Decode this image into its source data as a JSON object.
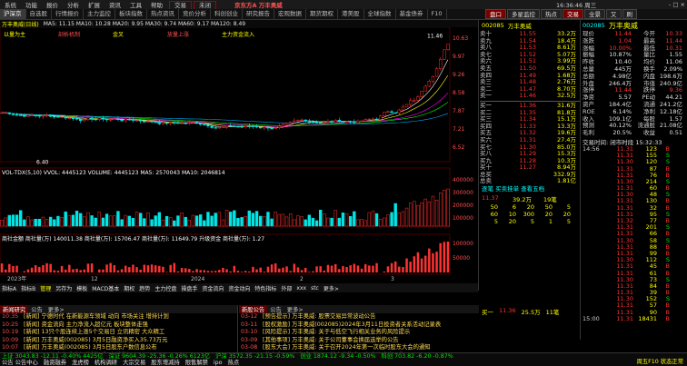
{
  "window": {
    "menu": [
      "系统",
      "功能",
      "报价",
      "分析",
      "扩展",
      "资讯",
      "工具",
      "帮助"
    ],
    "brand": "京东方A  万丰奥威",
    "broker_pills": [
      "交易",
      "未闭"
    ],
    "clock": "16:36:46 周三",
    "controls": "- □ ×"
  },
  "tabs": [
    "沪深京",
    "自选股",
    "行情报价",
    "主力监控",
    "板块指数",
    "热点资讯",
    "竞价分析",
    "科创创业",
    "研究报告",
    "宏观数据",
    "期货期权",
    "港美股",
    "全球指数",
    "基金债券",
    "F10"
  ],
  "active_tab": "沪深京",
  "right_tabs": [
    {
      "label": "盘口",
      "red": true
    },
    {
      "label": "多星监控",
      "red": false
    },
    {
      "label": "热点",
      "red": false
    },
    {
      "label": "交易",
      "red": true
    },
    {
      "label": "全景",
      "red": false
    },
    {
      "label": "又",
      "red": false
    },
    {
      "label": "刷",
      "red": false
    }
  ],
  "chart": {
    "stock_title": "万丰奥威(日线)",
    "ma_line": "MA5: 11.15  MA10: 10.28  MA20: 9.95  MA30: 9.74  MA60: 9.17  MA120: 8.49",
    "kline_labels": [
      "以量为主",
      "剖析机制",
      "金叉",
      "放量上涨",
      "主力资金流入"
    ],
    "price_high_label": "11.46",
    "price_low_label": "6.40",
    "price_axis": [
      "10.63",
      "9.97",
      "9.26",
      "8.58",
      "7.87",
      "7.21",
      "6.52"
    ],
    "volume_label": "VOL-TDX(5,10)  VVOL: 4445123  VOLUME: 4445123  MA5: 2570043  MA10: 2046814",
    "volume_axis": [
      "400000",
      "300000",
      "200000",
      "100000"
    ],
    "macd_label": "商社金额 商社量(万) 140011.38  商社量(万): 15706.47  商社量(万): 11649.79  升级资金 商社量(万): 1.27",
    "macd_axis": [
      "100000",
      "50000"
    ],
    "date_labels": [
      "2023年",
      "12",
      "2024",
      "2",
      "3"
    ],
    "bottom_tabs": [
      "指标A",
      "指标B",
      "管理",
      "另存为",
      "模板",
      "MACD基本",
      "期权",
      "趋势",
      "主力控盘",
      "操盘手",
      "资金流向",
      "资金动向",
      "特色指标",
      "外部",
      "xxx",
      "stc",
      "更多>"
    ]
  },
  "quote": {
    "stock_code": "002085",
    "stock_name": "万丰奥威",
    "sells": [
      {
        "label": "卖十",
        "price": "11.55",
        "vol": "33.2万"
      },
      {
        "label": "卖九",
        "price": "11.54",
        "vol": "18.4万"
      },
      {
        "label": "卖八",
        "price": "11.53",
        "vol": "8.61万"
      },
      {
        "label": "卖七",
        "price": "11.52",
        "vol": "5.07万"
      },
      {
        "label": "卖六",
        "price": "11.51",
        "vol": "3.99万"
      },
      {
        "label": "卖五",
        "price": "11.50",
        "vol": "69.5万"
      },
      {
        "label": "卖四",
        "price": "11.49",
        "vol": "1.68万"
      },
      {
        "label": "卖三",
        "price": "11.48",
        "vol": "2.76万"
      },
      {
        "label": "卖二",
        "price": "11.47",
        "vol": "8.70万"
      },
      {
        "label": "卖一",
        "price": "11.46",
        "vol": "32.5万"
      }
    ],
    "buys": [
      {
        "label": "买一",
        "price": "11.36",
        "vol": "31.6万"
      },
      {
        "label": "买二",
        "price": "11.35",
        "vol": "81.8万"
      },
      {
        "label": "买三",
        "price": "11.34",
        "vol": "15.1万"
      },
      {
        "label": "买四",
        "price": "11.33",
        "vol": "13.3万"
      },
      {
        "label": "买五",
        "price": "11.32",
        "vol": "19.6万"
      },
      {
        "label": "买六",
        "price": "11.31",
        "vol": "27.4万"
      },
      {
        "label": "买七",
        "price": "11.30",
        "vol": "85.0万"
      },
      {
        "label": "买八",
        "price": "11.29",
        "vol": "15.3万"
      },
      {
        "label": "买九",
        "price": "11.28",
        "vol": "10.3万"
      },
      {
        "label": "买十",
        "price": "11.27",
        "vol": "8.94万"
      }
    ],
    "sum_rows": [
      {
        "label": "总买",
        "price": "",
        "vol": "332.9万"
      },
      {
        "label": "总卖",
        "price": "",
        "vol": "1.81亿"
      }
    ],
    "hint": "逐笔 买卖挂单 查看五档",
    "big_order_hdr": [
      "11.37",
      "39.2万",
      "19笔"
    ],
    "big_order_rows": [
      [
        "50",
        "6",
        "20",
        "50",
        "5"
      ],
      [
        "60",
        "10",
        "300",
        "20",
        "20"
      ],
      [
        "5",
        "20",
        "5",
        "1",
        "5"
      ]
    ],
    "bottom_order": {
      "label": "买一",
      "price": "11.36",
      "vol": "25.5万",
      "count": "11笔"
    }
  },
  "info": {
    "code": "002085",
    "name": "万丰奥威",
    "rows": [
      [
        "现价",
        "11.44",
        "今开",
        "10.33"
      ],
      [
        "涨跌",
        "1.04",
        "最高",
        "11.44"
      ],
      [
        "涨幅",
        "10.00%",
        "最低",
        "10.31"
      ],
      [
        "振幅",
        "10.87%",
        "量比",
        "1.55"
      ],
      [
        "昨收",
        "10.40",
        "均价",
        "11.06"
      ],
      [
        "总量",
        "445万",
        "换手",
        "2.09%"
      ],
      [
        "总额",
        "4.98亿",
        "内盘",
        "198.6万"
      ],
      [
        "外盘",
        "246.4万",
        "市值",
        "240.9亿"
      ],
      [
        "涨停",
        "11.44",
        "跌停",
        "9.36"
      ],
      [
        "净资",
        "5.57",
        "PE动",
        "44.21"
      ],
      [
        "资产",
        "184.4亿",
        "流通",
        "241.2亿"
      ],
      [
        "ROE",
        "6.14%",
        "净利",
        "12.18亿"
      ],
      [
        "收入",
        "109.1亿",
        "每股",
        "1.57"
      ],
      [
        "预测",
        "40.12%",
        "流通股",
        "21.08亿"
      ],
      [
        "毛利",
        "20.5%",
        "收益",
        "0.51"
      ]
    ],
    "session": "交易时间: 闭市时段  15:32:33",
    "ticks": [
      [
        "14:56",
        "11.31",
        "123",
        "B"
      ],
      [
        "",
        "11.31",
        "155",
        "S"
      ],
      [
        "",
        "11.30",
        "120",
        "S"
      ],
      [
        "",
        "11.31",
        "87",
        "B"
      ],
      [
        "",
        "11.31",
        "76",
        "B"
      ],
      [
        "",
        "11.30",
        "214",
        "S"
      ],
      [
        "",
        "11.31",
        "60",
        "B"
      ],
      [
        "",
        "11.30",
        "48",
        "S"
      ],
      [
        "",
        "11.31",
        "130",
        "B"
      ],
      [
        "",
        "11.31",
        "32",
        "B"
      ],
      [
        "",
        "11.31",
        "95",
        "S"
      ],
      [
        "",
        "11.32",
        "77",
        "B"
      ],
      [
        "",
        "11.31",
        "201",
        "S"
      ],
      [
        "",
        "11.31",
        "66",
        "B"
      ],
      [
        "",
        "11.30",
        "58",
        "S"
      ],
      [
        "",
        "11.31",
        "88",
        "B"
      ],
      [
        "",
        "11.31",
        "99",
        "B"
      ],
      [
        "",
        "11.30",
        "112",
        "S"
      ],
      [
        "",
        "11.31",
        "45",
        "B"
      ],
      [
        "",
        "11.31",
        "61",
        "B"
      ],
      [
        "",
        "11.30",
        "73",
        "S"
      ],
      [
        "",
        "11.31",
        "84",
        "B"
      ],
      [
        "",
        "11.31",
        "39",
        "B"
      ],
      [
        "",
        "11.30",
        "152",
        "S"
      ],
      [
        "",
        "11.31",
        "57",
        "B"
      ],
      [
        "",
        "11.31",
        "90",
        "B"
      ],
      [
        "15:00",
        "11.31",
        "18431",
        "B"
      ]
    ]
  },
  "news": {
    "left_tabs": [
      "新闻研究",
      "公告",
      "更多>"
    ],
    "left_items": [
      {
        "time": "10:35",
        "text": "[新闻] 宁德时代 在新能源车领域 动向 市场关注 增持计划"
      },
      {
        "time": "10:25",
        "text": "[新闻] 资金流向 主力净流入超亿元 板块整体走强"
      },
      {
        "time": "10:19",
        "text": "[新闻] 13只个股连续上涨5个交易日 立讯精密 大众精工"
      },
      {
        "time": "10:09",
        "text": "[新闻] 万丰奥威(002085) 3月5日融资净买入35.73万元"
      },
      {
        "time": "10:07",
        "text": "[新闻] 万丰奥威(002085) 3月5日股东户数信息公布"
      },
      {
        "time": "10:04",
        "text": "[新闻] 1月汽车行业市场分析报告 产销数据回顾"
      }
    ],
    "right_tabs": [
      "新股公告",
      "公告",
      "更多>"
    ],
    "right_items": [
      {
        "time": "03-12",
        "text": "[预告提示]  万丰奥威: 股票交易异常波动公告"
      },
      {
        "time": "03-11",
        "text": "[股权激励]  万丰奥威(002085)2024年3月11日投资者关系活动记录表"
      },
      {
        "time": "03-10",
        "text": "[风险提示]  万丰奥威: 关于与低空飞行相关业务的风险提示"
      },
      {
        "time": "03-09",
        "text": "[其他事项]  万丰奥威: 关于公司董事会换届选举的公告"
      },
      {
        "time": "03-08",
        "text": "[股东大会]  万丰奥威: 关于召开2024年第一次临时股东大会的通知"
      },
      {
        "time": "03-07",
        "text": "[董事会]  万丰奥威: 第八届董事会第十五次会议决议公告"
      }
    ]
  },
  "bottom": {
    "indices_row1": [
      "上证 3043.83  -12.11  -0.40%  4425亿",
      "深证 9604.39  -25.36  -0.26%  6123亿",
      "沪深 3572.35  -21.15  -0.59%",
      "创业 1874.12  -9.34  -0.50%",
      "科创 703.82  -6.20  -0.87%"
    ],
    "indices_row2": [
      "公告 公告中心",
      "融资融券",
      "龙虎榜",
      "机构调研",
      "大宗交易",
      "股东增减持",
      "限售解禁",
      "ipo",
      "热点"
    ],
    "status": "周五F10 状态正常"
  }
}
